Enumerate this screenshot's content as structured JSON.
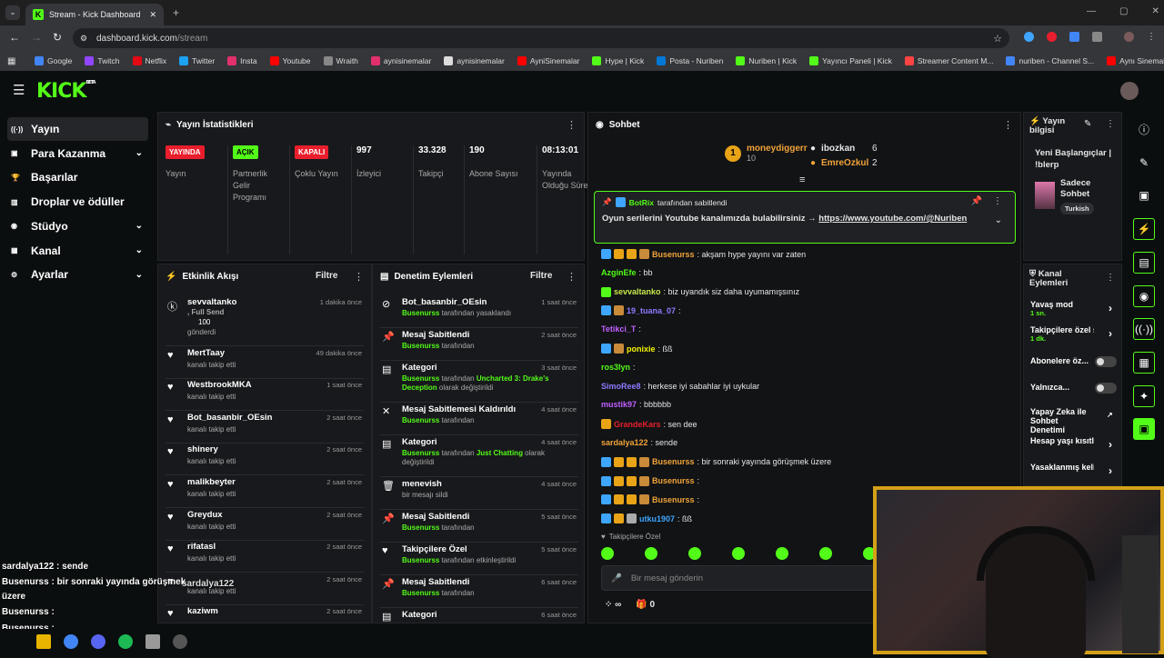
{
  "browser": {
    "tab_title": "Stream - Kick Dashboard",
    "url_host": "dashboard.kick.com",
    "url_path": "/stream",
    "bookmarks": [
      {
        "label": "Google",
        "color": "#4285f4"
      },
      {
        "label": "Twitch",
        "color": "#9146ff"
      },
      {
        "label": "Netflix",
        "color": "#e50914"
      },
      {
        "label": "Twitter",
        "color": "#1da1f2"
      },
      {
        "label": "Insta",
        "color": "#e1306c"
      },
      {
        "label": "Youtube",
        "color": "#ff0000"
      },
      {
        "label": "Wraith",
        "color": "#888888"
      },
      {
        "label": "aynisinemalar",
        "color": "#e1306c"
      },
      {
        "label": "aynisinemalar",
        "color": "#dddddd"
      },
      {
        "label": "AyniSinemalar",
        "color": "#ff0000"
      },
      {
        "label": "Hype | Kick",
        "color": "#53fc18"
      },
      {
        "label": "Posta - Nuriben",
        "color": "#0078d4"
      },
      {
        "label": "Nuriben | Kick",
        "color": "#53fc18"
      },
      {
        "label": "Yayıncı Paneli | Kick",
        "color": "#53fc18"
      },
      {
        "label": "Streamer Content M...",
        "color": "#ff4444"
      },
      {
        "label": "nuriben - Channel S...",
        "color": "#4285f4"
      },
      {
        "label": "Aynı Sinemalar - Ça...",
        "color": "#ff0000"
      }
    ]
  },
  "app": {
    "logo": "KICK",
    "logo_sup": "BETA",
    "accent": "#53fc18"
  },
  "sidebar": {
    "items": [
      {
        "label": "Yayın",
        "icon": "broadcast-icon",
        "active": true
      },
      {
        "label": "Para Kazanma",
        "icon": "money-icon",
        "chevron": true
      },
      {
        "label": "Başarılar",
        "icon": "trophy-icon"
      },
      {
        "label": "Droplar ve ödüller",
        "icon": "gift-icon"
      },
      {
        "label": "Stüdyo",
        "icon": "studio-icon",
        "chevron": true
      },
      {
        "label": "Kanal",
        "icon": "channel-icon",
        "chevron": true
      },
      {
        "label": "Ayarlar",
        "icon": "gear-icon",
        "chevron": true
      }
    ]
  },
  "stats": {
    "title": "Yayın İstatistikleri",
    "cells": [
      {
        "badge": "YAYINDA",
        "badge_color": "#e91e2c",
        "label": "Yayın"
      },
      {
        "badge": "AÇIK",
        "badge_color": "#53fc18",
        "label": "Partnerlik Gelir Programı"
      },
      {
        "badge": "KAPALI",
        "badge_color": "#e91e2c",
        "label": "Çoklu Yayın"
      },
      {
        "value": "997",
        "label": "İzleyici"
      },
      {
        "value": "33.328",
        "label": "Takipçi"
      },
      {
        "value": "190",
        "label": "Abone Sayısı"
      },
      {
        "value": "08:13:01",
        "label": "Yayında Olduğu Süre"
      }
    ]
  },
  "activity": {
    "title": "Etkinlik Akışı",
    "filter": "Filtre",
    "events": [
      {
        "name": "sevvaltanko",
        "line2": ", Full Send",
        "line3": "100",
        "line4": "gönderdi",
        "time": "1 dakika önce"
      },
      {
        "name": "MertTaay",
        "sub": "kanalı takip etti",
        "time": "49 dakika önce"
      },
      {
        "name": "WestbrookMKA",
        "sub": "kanalı takip etti",
        "time": "1 saat önce"
      },
      {
        "name": "Bot_basanbir_OEsin",
        "sub": "kanalı takip etti",
        "time": "2 saat önce"
      },
      {
        "name": "shinery",
        "sub": "kanalı takip etti",
        "time": "2 saat önce"
      },
      {
        "name": "malikbeyter",
        "sub": "kanalı takip etti",
        "time": "2 saat önce"
      },
      {
        "name": "Greydux",
        "sub": "kanalı takip etti",
        "time": "2 saat önce"
      },
      {
        "name": "rifatasl",
        "sub": "kanalı takip etti",
        "time": "2 saat önce"
      },
      {
        "name": "",
        "sub": "kanalı takip etti",
        "time": "2 saat önce"
      },
      {
        "name": "kaziwm",
        "sub": "",
        "time": "2 saat önce"
      }
    ]
  },
  "moderation": {
    "title": "Denetim Eylemleri",
    "filter": "Filtre",
    "actions": [
      {
        "name": "Bot_basanbir_OEsin",
        "who": "Busenurss",
        "rest": " tarafından yasaklandı",
        "time": "1 saat önce"
      },
      {
        "name": "Mesaj Sabitlendi",
        "who": "Busenurss",
        "rest": " tarafından",
        "time": "2 saat önce"
      },
      {
        "name": "Kategori",
        "who": "Busenurss",
        "rest": " tarafından ",
        "hl": "Uncharted 3: Drake's Deception",
        "rest2": " olarak değiştirildi",
        "time": "3 saat önce"
      },
      {
        "name": "Mesaj Sabitlemesi Kaldırıldı",
        "who": "Busenurss",
        "rest": " tarafından",
        "time": "4 saat önce"
      },
      {
        "name": "Kategori",
        "who": "Busenurss",
        "rest": " tarafından ",
        "hl": "Just Chatting",
        "rest2": " olarak değiştirildi",
        "time": "4 saat önce"
      },
      {
        "name": "menevish",
        "who": "",
        "rest": "bir mesajı sildi",
        "time": "4 saat önce"
      },
      {
        "name": "Mesaj Sabitlendi",
        "who": "Busenurss",
        "rest": " tarafından",
        "time": "5 saat önce"
      },
      {
        "name": "Takipçilere Özel",
        "who": "Busenurss",
        "rest": " tarafından etkinleştirildi",
        "time": "5 saat önce"
      },
      {
        "name": "Mesaj Sabitlendi",
        "who": "Busenurss",
        "rest": " tarafından",
        "time": "6 saat önce"
      },
      {
        "name": "Kategori",
        "who": "",
        "rest": "",
        "time": "6 saat önce"
      }
    ]
  },
  "chat": {
    "title": "Sohbet",
    "top": [
      {
        "name": "moneydiggerr",
        "count": "10"
      },
      {
        "name": "ibozkan",
        "count": "6"
      },
      {
        "name": "EmreOzkul",
        "count": "2"
      }
    ],
    "pinned_by": "BotRix",
    "pinned_by_rest": "tarafından sabitlendi",
    "pinned_text": "Oyun serilerini Youtube kanalımızda bulabilirsiniz → ",
    "pinned_link": "https://www.youtube.com/@Nuriben",
    "messages": [
      {
        "user": "Busenurss",
        "color": "#f0a33a",
        "text": ": akşam hype yayını var zaten",
        "badges": [
          "#3ea6ff",
          "#e8a317",
          "#e8a317",
          "#c98a3a"
        ]
      },
      {
        "user": "AzginEfe",
        "color": "#53fc18",
        "text": ": bb",
        "badges": []
      },
      {
        "user": "sevvaltanko",
        "color": "#c8e84a",
        "text": ": biz uyandık siz daha uyumamışsınız",
        "badges": [
          "#53fc18"
        ]
      },
      {
        "user": "19_tuana_07",
        "color": "#8c7cff",
        "text": ":",
        "badges": [
          "#3ea6ff",
          "#c98a3a"
        ]
      },
      {
        "user": "Tetikci_T",
        "color": "#c060ff",
        "text": ":",
        "badges": []
      },
      {
        "user": "ponixie",
        "color": "#f5f500",
        "text": ": ßß",
        "badges": [
          "#3ea6ff",
          "#c98a3a"
        ]
      },
      {
        "user": "ros3lyn",
        "color": "#53fc18",
        "text": ":",
        "badges": []
      },
      {
        "user": "SimoRee8",
        "color": "#8c7cff",
        "text": ": herkese iyi sabahlar iyi uykular",
        "badges": []
      },
      {
        "user": "mustik97",
        "color": "#c060ff",
        "text": ": bbbbbb",
        "badges": []
      },
      {
        "user": "GrandeKars",
        "color": "#e91e2c",
        "text": ": sen dee",
        "badges": [
          "#e8a317"
        ]
      },
      {
        "user": "sardalya122",
        "color": "#f0a33a",
        "text": ": sende",
        "badges": []
      },
      {
        "user": "Busenurss",
        "color": "#f0a33a",
        "text": ": bir sonraki yayında görüşmek üzere",
        "badges": [
          "#3ea6ff",
          "#e8a317",
          "#e8a317",
          "#c98a3a"
        ]
      },
      {
        "user": "Busenurss",
        "color": "#f0a33a",
        "text": ":",
        "badges": [
          "#3ea6ff",
          "#e8a317",
          "#e8a317",
          "#c98a3a"
        ]
      },
      {
        "user": "Busenurss",
        "color": "#f0a33a",
        "text": ":",
        "badges": [
          "#3ea6ff",
          "#e8a317",
          "#e8a317",
          "#c98a3a"
        ]
      },
      {
        "user": "utku1907",
        "color": "#3ea6ff",
        "text": ": ßß",
        "badges": [
          "#3ea6ff",
          "#e8a317",
          "#aaaaaa"
        ]
      }
    ],
    "followers_only": "Takipçilere Özel",
    "input_placeholder": "Bir mesaj gönderin",
    "infinity": "∞",
    "gift_count": "0"
  },
  "info": {
    "title": "Yayın bilgisi",
    "stream_title": "Yeni Başlangıçlar | !blerp",
    "category": "Sadece Sohbet",
    "tag": "Turkish"
  },
  "channel_actions": {
    "title": "Kanal Eylemleri",
    "items": [
      {
        "label": "Yavaş mod",
        "sub": "1 sn.",
        "type": "arrow"
      },
      {
        "label": "Takipçilere özel s",
        "sub": "1 dk.",
        "type": "arrow"
      },
      {
        "label": "Abonelere öz...",
        "type": "toggle"
      },
      {
        "label": "Yalnızca...",
        "type": "toggle"
      },
      {
        "label": "Yapay Zeka ile Sohbet Denetimi",
        "type": "external"
      },
      {
        "label": "Hesap yaşı kısıtla",
        "type": "arrow"
      },
      {
        "label": "Yasaklanmış kelin",
        "type": "arrow"
      }
    ]
  },
  "overlay": {
    "lines": [
      "sardalya122 : sende",
      "Busenurss : bir sonraki yayında görüşmek",
      "üzere",
      "Busenurss :",
      "Busenurss :",
      "utku1907 : ßß"
    ],
    "partial": "sardalya122"
  }
}
